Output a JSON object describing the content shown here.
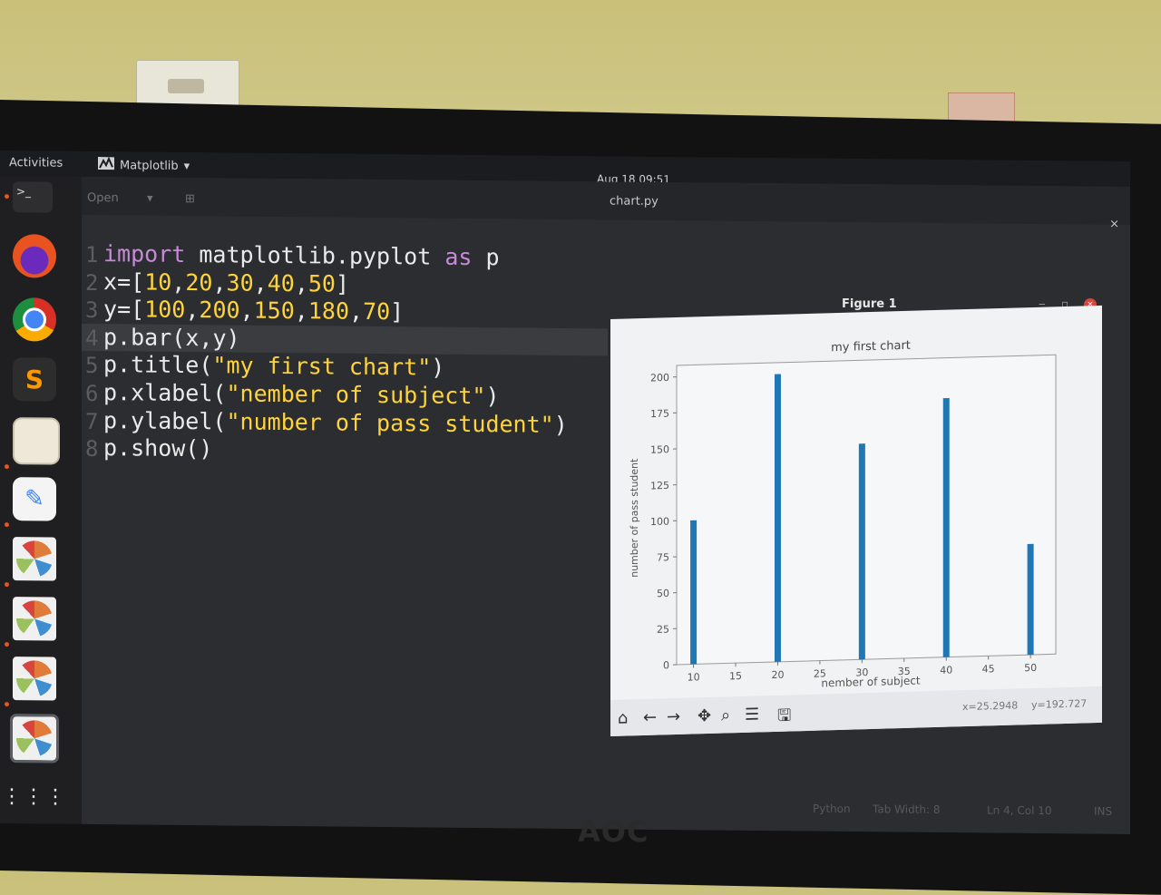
{
  "topbar": {
    "activities": "Activities",
    "app_name": "Matplotlib",
    "clock": "Aug 18 09:51"
  },
  "editor": {
    "open_label": "Open",
    "file_title": "chart.py",
    "code_lines": [
      {
        "num": "1",
        "text": "import matplotlib.pyplot as p"
      },
      {
        "num": "2",
        "text": "x=[10,20,30,40,50]"
      },
      {
        "num": "3",
        "text": "y=[100,200,150,180,70]"
      },
      {
        "num": "4",
        "text": "p.bar(x,y)"
      },
      {
        "num": "5",
        "text": "p.title(\"my first chart\")"
      },
      {
        "num": "6",
        "text": "p.xlabel(\"nember of subject\")"
      },
      {
        "num": "7",
        "text": "p.ylabel(\"number of pass student\")"
      },
      {
        "num": "8",
        "text": "p.show()"
      }
    ],
    "highlighted_line": 4,
    "status": {
      "language": "Python",
      "tab_width": "Tab Width: 8",
      "cursor": "Ln 4, Col 10",
      "mode": "INS"
    }
  },
  "figure_window": {
    "title": "Figure 1",
    "coord_x": "x=25.2948",
    "coord_y": "y=192.727"
  },
  "chart_data": {
    "type": "bar",
    "title": "my first chart",
    "xlabel": "nember of subject",
    "ylabel": "number of pass student",
    "x": [
      10,
      20,
      30,
      40,
      50
    ],
    "values": [
      100,
      200,
      150,
      180,
      77
    ],
    "xticks": [
      "10",
      "15",
      "20",
      "25",
      "30",
      "35",
      "40",
      "45",
      "50"
    ],
    "yticks": [
      "0",
      "25",
      "50",
      "75",
      "100",
      "125",
      "150",
      "175",
      "200"
    ],
    "xlim": [
      8,
      53
    ],
    "ylim": [
      0,
      208
    ],
    "bar_color": "#1f77b4",
    "grid": false
  },
  "dock": {
    "items": [
      "firefox-icon",
      "chrome-icon",
      "sublime-icon",
      "files-icon",
      "text-editor-icon",
      "matplotlib-icon",
      "matplotlib-icon",
      "matplotlib-icon",
      "matplotlib-icon",
      "app-grid-icon"
    ]
  },
  "brand": "AOC"
}
